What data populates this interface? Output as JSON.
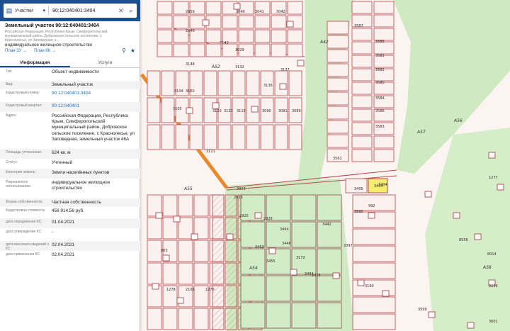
{
  "search": {
    "category": "Участки",
    "query": "90:12:040401:3404"
  },
  "parcel": {
    "title": "Земельный участок 90:12:040401:3404",
    "address_small": "Российская Федерация, Республика Крым, Симферопольский муниципальный район, Добровское сельское поселение, с Краснолесье, ул Заповедная, з...",
    "use_line": "индивидуальное жилищное строительство",
    "plan_zu": "План ЗУ",
    "plan_kk": "План КК"
  },
  "tabs": {
    "info": "Информация",
    "services": "Услуги"
  },
  "properties": [
    {
      "key": "Тип:",
      "value": "Объект недвижимости"
    },
    {
      "key": "Вид:",
      "value": "Земельный участок"
    },
    {
      "key": "Кадастровый номер:",
      "value": "90:12:040401:3404"
    },
    {
      "key": "Кадастровый квартал:",
      "value": "90:12:040401"
    },
    {
      "key": "Адрес:",
      "value": "Российская Федерация, Республика Крым, Симферопольский муниципальный район, Добровское сельское поселение, с Краснолесье, ул Заповедная, земельный участок 46А"
    },
    {
      "key": "Площадь уточненная:",
      "value": "624 кв. м"
    },
    {
      "key": "Статус:",
      "value": "Учтенный"
    },
    {
      "key": "Категория земель:",
      "value": "Земли населённых пунктов"
    },
    {
      "key": "Разрешенное использование:",
      "value": "индивидуальное жилищное строительство"
    },
    {
      "key": "Форма собственности:",
      "value": "Частная собственность"
    },
    {
      "key": "Кадастровая стоимость:",
      "value": "458 914,56 руб."
    },
    {
      "key": "дата определения КС:",
      "value": "01.04.2021"
    },
    {
      "key": "дата утверждения КС:",
      "value": "-"
    },
    {
      "key": "дата внесения сведений о КС:",
      "value": "02.04.2021"
    },
    {
      "key": "дата применения КС:",
      "value": "02.04.2021"
    }
  ],
  "map": {
    "zone_labels": [
      "А52",
      "А55",
      "А42",
      "А56",
      "А57",
      "А58",
      "А54"
    ],
    "plot_numbers": [
      "2959",
      "3040",
      "3041",
      "3042",
      "2940",
      "3142",
      "3029",
      "3148",
      "3132",
      "3137",
      "3160",
      "3136",
      "3118",
      "3120",
      "3104",
      "3121",
      "3105",
      "3120",
      "3090",
      "3091",
      "3089",
      "3587",
      "3588",
      "3581",
      "3582",
      "3585",
      "3584",
      "3586",
      "3583",
      "3561",
      "3405",
      "3404",
      "3590",
      "992",
      "2923",
      "2925",
      "2926",
      "2928",
      "3464",
      "3442",
      "3453",
      "3455",
      "3446",
      "3465",
      "3172",
      "3484",
      "3160",
      "3599",
      "3397",
      "803",
      "1278",
      "2101",
      "1276",
      "1277",
      "8014",
      "9256",
      "3601",
      "8556"
    ],
    "selected_parcel": "3404",
    "colors": {
      "header": "#1e4f8f",
      "boundary": "#b5474c",
      "green_area": "#cfeac3",
      "selected": "#f3ee6f",
      "road": "#e8892a"
    }
  }
}
